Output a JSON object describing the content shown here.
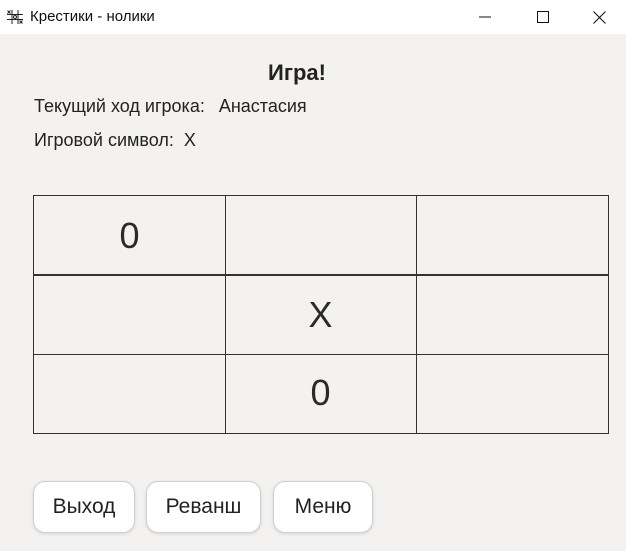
{
  "window": {
    "title": "Крестики - нолики"
  },
  "header": {
    "title": "Игра!",
    "turn_label": "Текущий ход игрока:",
    "turn_value": "Анастасия",
    "symbol_label": "Игровой символ:",
    "symbol_value": "X"
  },
  "board": {
    "rows": [
      [
        "0",
        "",
        ""
      ],
      [
        "",
        "X",
        ""
      ],
      [
        "",
        "0",
        ""
      ]
    ]
  },
  "buttons": {
    "exit": "Выход",
    "rematch": "Реванш",
    "menu": "Меню"
  }
}
